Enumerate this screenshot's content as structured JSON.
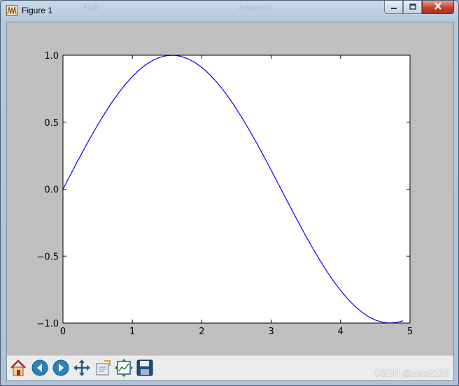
{
  "window": {
    "title": "Figure 1",
    "buttons": {
      "minimize": "minimize",
      "maximize": "maximize",
      "close": "close"
    }
  },
  "background_titles": [
    "Fork",
    "Argument"
  ],
  "chart_data": {
    "type": "line",
    "title": "",
    "xlabel": "",
    "ylabel": "",
    "xlim": [
      0,
      5
    ],
    "ylim": [
      -1.0,
      1.0
    ],
    "xticks": [
      "0",
      "1",
      "2",
      "3",
      "4",
      "5"
    ],
    "yticks": [
      "1.0",
      "0.5",
      "0.0",
      "−0.5",
      "−1.0"
    ],
    "ytick_values": [
      1.0,
      0.5,
      0.0,
      -0.5,
      -1.0
    ],
    "grid": false,
    "series": [
      {
        "color": "#0000ff",
        "x": [
          0.0,
          0.1,
          0.2,
          0.3,
          0.4,
          0.5,
          0.6,
          0.7,
          0.8,
          0.9,
          1.0,
          1.1,
          1.2,
          1.3,
          1.4,
          1.5,
          1.6,
          1.7,
          1.8,
          1.9,
          2.0,
          2.1,
          2.2,
          2.3,
          2.4,
          2.5,
          2.6,
          2.7,
          2.8,
          2.9,
          3.0,
          3.1,
          3.2,
          3.3,
          3.4,
          3.5,
          3.6,
          3.7,
          3.8,
          3.9,
          4.0,
          4.1,
          4.2,
          4.3,
          4.4,
          4.5,
          4.6,
          4.7,
          4.8,
          4.9
        ],
        "y": [
          0.0,
          0.0998,
          0.1987,
          0.2955,
          0.3894,
          0.4794,
          0.5646,
          0.6442,
          0.7174,
          0.7833,
          0.8415,
          0.8912,
          0.932,
          0.9636,
          0.9854,
          0.9975,
          0.9996,
          0.9917,
          0.9738,
          0.9463,
          0.9093,
          0.8632,
          0.8085,
          0.7457,
          0.6755,
          0.5985,
          0.5155,
          0.4274,
          0.335,
          0.2392,
          0.1411,
          0.0416,
          -0.0584,
          -0.1577,
          -0.2555,
          -0.3508,
          -0.4425,
          -0.5298,
          -0.6119,
          -0.6878,
          -0.7568,
          -0.8183,
          -0.8716,
          -0.9162,
          -0.9516,
          -0.9775,
          -0.9937,
          -0.9999,
          -0.9962,
          -0.9825
        ]
      }
    ]
  },
  "toolbar": {
    "buttons": [
      {
        "name": "home-button",
        "icon": "home-icon"
      },
      {
        "name": "back-button",
        "icon": "back-arrow-icon"
      },
      {
        "name": "forward-button",
        "icon": "forward-arrow-icon"
      },
      {
        "name": "pan-button",
        "icon": "move-icon"
      },
      {
        "name": "zoom-button",
        "icon": "zoom-rect-icon"
      },
      {
        "name": "subplots-button",
        "icon": "subplots-icon"
      },
      {
        "name": "save-button",
        "icon": "floppy-disk-icon"
      }
    ]
  },
  "watermark": "CSDN @zero2100",
  "colors": {
    "figure_bg": "#bfbfbf",
    "axes_bg": "#ffffff",
    "line": "#0000ff",
    "toolbar_bg": "#ececec"
  }
}
